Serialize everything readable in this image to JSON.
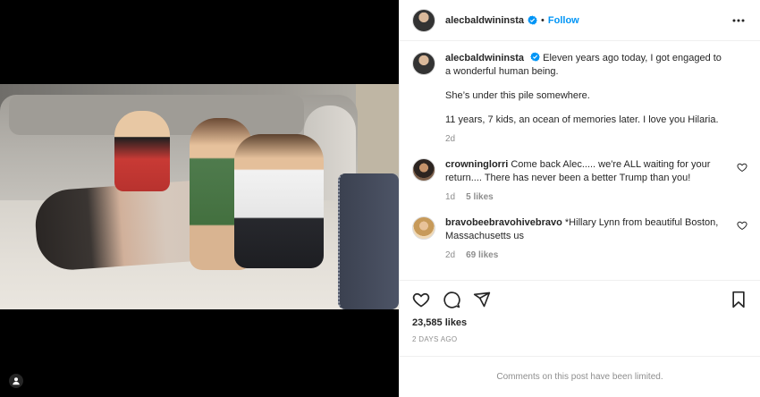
{
  "post": {
    "username": "alecbaldwininsta",
    "follow_label": "Follow",
    "separator": "•",
    "caption": {
      "line1": "Eleven years ago today, I got engaged to a wonderful human being.",
      "line2": "She’s under this pile somewhere.",
      "line3": "11 years, 7 kids, an ocean of memories later. I love you Hilaria.",
      "age": "2d"
    }
  },
  "comments": [
    {
      "username": "crowninglorri",
      "text": "Come back Alec..... we're ALL waiting for your return.... There has never been a better Trump than you!",
      "age": "1d",
      "likes": "5 likes"
    },
    {
      "username": "bravobeebravohivebravo",
      "text": "*Hillary Lynn from beautiful Boston, Massachusetts us",
      "age": "2d",
      "likes": "69 likes"
    }
  ],
  "actions": {
    "likes": "23,585 likes",
    "date": "2 DAYS AGO",
    "limited_notice": "Comments on this post have been limited."
  },
  "icons": {
    "more": "more-options-icon",
    "verified": "verified-badge-icon",
    "like": "heart-icon",
    "comment": "comment-icon",
    "share": "share-icon",
    "save": "bookmark-icon",
    "user": "user-tag-icon"
  },
  "colors": {
    "accent": "#0095f6",
    "muted": "#8e8e8e",
    "text": "#262626"
  }
}
